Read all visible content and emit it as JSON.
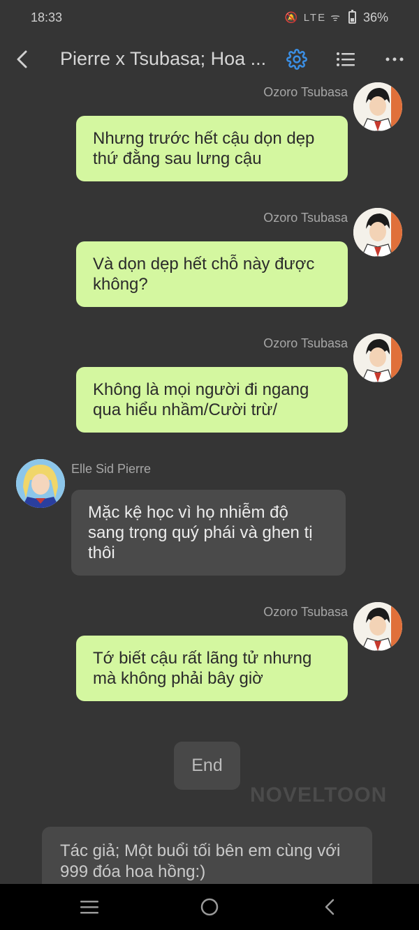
{
  "status_bar": {
    "time": "18:33",
    "icons": "🔕 LTE ᯤ",
    "battery": "36%"
  },
  "header": {
    "title": "Pierre x Tsubasa; Hoa ...",
    "back_icon": "chevron-left-icon",
    "settings_icon": "gear-icon",
    "list_icon": "list-icon",
    "more_icon": "more-horizontal-icon",
    "accent_color": "#3b8fe5"
  },
  "messages": [
    {
      "sender": "Ozoro Tsubasa",
      "side": "right",
      "text": "Nhưng trước hết cậu dọn dẹp thứ đằng sau lưng cậu"
    },
    {
      "sender": "Ozoro Tsubasa",
      "side": "right",
      "text": "Và dọn dẹp hết chỗ này được không?"
    },
    {
      "sender": "Ozoro Tsubasa",
      "side": "right",
      "text": "Không là mọi người đi ngang qua hiểu nhầm/Cười trừ/"
    },
    {
      "sender": "Elle Sid Pierre",
      "side": "left",
      "text": "Mặc kệ học vì họ nhiễm độ sang trọng quý phái và ghen tị thôi"
    },
    {
      "sender": "Ozoro Tsubasa",
      "side": "right",
      "text": "Tớ biết cậu rất lãng tử nhưng mà không phải bây giờ"
    }
  ],
  "end_label": "End",
  "watermark": "NOVELTOON",
  "author_note": "Tác giả; Một buổi tối bên em cùng với 999 đóa hoa hồng:)",
  "colors": {
    "background": "#353535",
    "bubble_right": "#d4f7a0",
    "bubble_left": "#4a4a4a"
  }
}
